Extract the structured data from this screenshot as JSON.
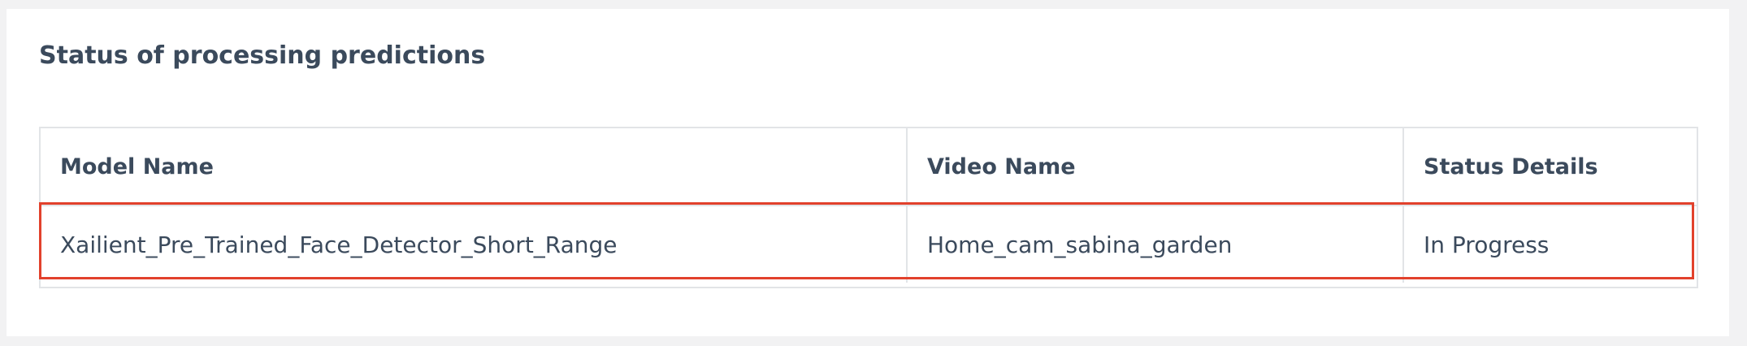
{
  "section": {
    "title": "Status of processing predictions"
  },
  "table": {
    "columns": [
      "Model Name",
      "Video Name",
      "Status Details"
    ],
    "rows": [
      {
        "model_name": "Xailient_Pre_Trained_Face_Detector_Short_Range",
        "video_name": "Home_cam_sabina_garden",
        "status": "In Progress"
      }
    ]
  },
  "colors": {
    "page_background": "#f2f2f3",
    "panel_background": "#ffffff",
    "text": "#3b4a5c",
    "border": "#e2e4e7",
    "highlight": "#e2412c"
  }
}
